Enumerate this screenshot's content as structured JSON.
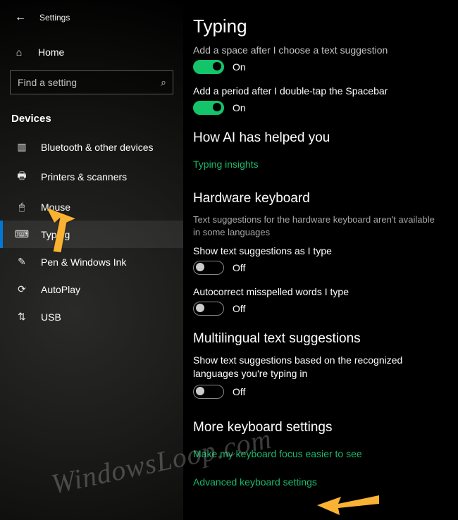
{
  "window": {
    "title": "Settings"
  },
  "sidebar": {
    "home_label": "Home",
    "search_placeholder": "Find a setting",
    "section": "Devices",
    "items": [
      {
        "label": "Bluetooth & other devices",
        "icon": "bluetooth-devices-icon",
        "selected": false
      },
      {
        "label": "Printers & scanners",
        "icon": "printer-icon",
        "selected": false
      },
      {
        "label": "Mouse",
        "icon": "mouse-icon",
        "selected": false
      },
      {
        "label": "Typing",
        "icon": "keyboard-icon",
        "selected": true
      },
      {
        "label": "Pen & Windows Ink",
        "icon": "pen-icon",
        "selected": false
      },
      {
        "label": "AutoPlay",
        "icon": "autoplay-icon",
        "selected": false
      },
      {
        "label": "USB",
        "icon": "usb-icon",
        "selected": false
      }
    ]
  },
  "content": {
    "page_title": "Typing",
    "opt_space": {
      "desc": "Add a space after I choose a text suggestion",
      "on": true,
      "on_label": "On"
    },
    "opt_period": {
      "desc": "Add a period after I double-tap the Spacebar",
      "on": true,
      "on_label": "On"
    },
    "ai_section": {
      "title": "How AI has helped you",
      "link": "Typing insights"
    },
    "hw_keyboard": {
      "title": "Hardware keyboard",
      "note": "Text suggestions for the hardware keyboard aren't available in some languages",
      "opt_suggest": {
        "desc": "Show text suggestions as I type",
        "on": false,
        "off_label": "Off"
      },
      "opt_autocorrect": {
        "desc": "Autocorrect misspelled words I type",
        "on": false,
        "off_label": "Off"
      }
    },
    "multilingual": {
      "title": "Multilingual text suggestions",
      "opt": {
        "desc": "Show text suggestions based on the recognized languages you're typing in",
        "on": false,
        "off_label": "Off"
      }
    },
    "more": {
      "title": "More keyboard settings",
      "link_focus": "Make my keyboard focus easier to see",
      "link_adv": "Advanced keyboard settings"
    }
  },
  "watermark": "WindowsLoop.com",
  "colors": {
    "accent_link": "#1bb86b",
    "toggle_on": "#14c46a",
    "nav_accent": "#0078d4",
    "arrow": "#f9b233"
  },
  "icon_glyphs": {
    "back-icon": "←",
    "home-icon": "⌂",
    "search-icon": "⌕",
    "bluetooth-devices-icon": "▥",
    "printer-icon": "🖶",
    "mouse-icon": "🖱",
    "keyboard-icon": "⌨",
    "pen-icon": "✎",
    "autoplay-icon": "⟳",
    "usb-icon": "⇅"
  }
}
